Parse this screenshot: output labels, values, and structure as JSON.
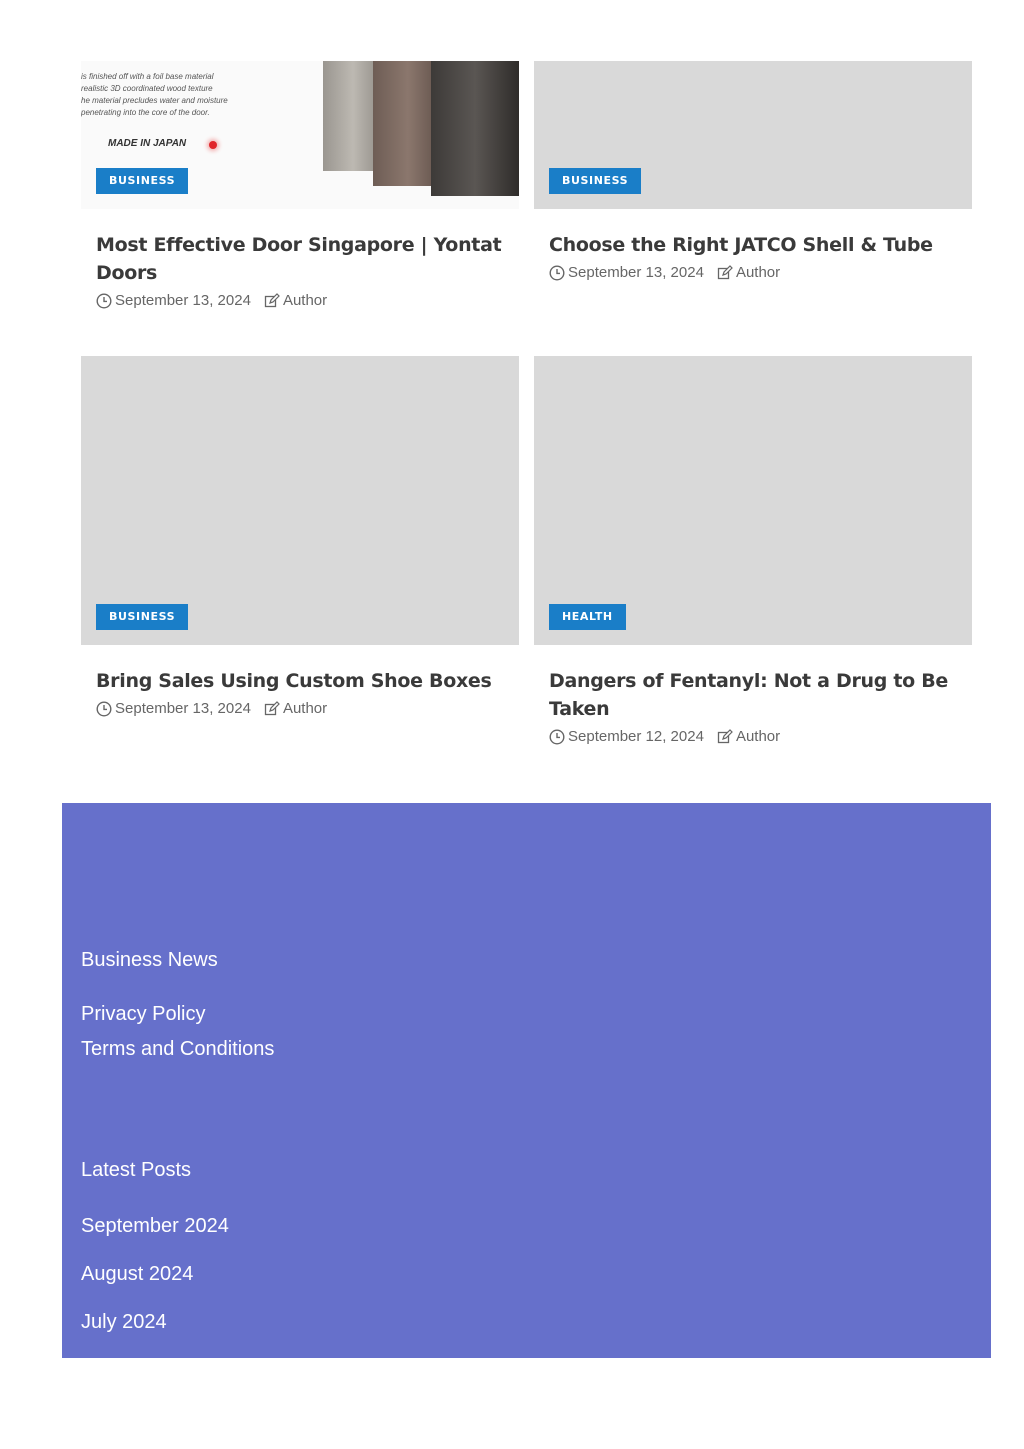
{
  "posts": [
    {
      "category": "BUSINESS",
      "title": "Most Effective Door Singapore | Yontat Doors",
      "date": "September 13, 2024",
      "author": "Author"
    },
    {
      "category": "BUSINESS",
      "title": "Choose the Right JATCO Shell & Tube",
      "date": "September 13, 2024",
      "author": "Author"
    },
    {
      "category": "BUSINESS",
      "title": "Bring Sales Using Custom Shoe Boxes",
      "date": "September 13, 2024",
      "author": "Author"
    },
    {
      "category": "HEALTH",
      "title": "Dangers of Fentanyl: Not a Drug to Be Taken",
      "date": "September 12, 2024",
      "author": "Author"
    }
  ],
  "door_image": {
    "lines": [
      "is finished off with a foil base material",
      "realistic 3D coordinated wood texture",
      "he material precludes water and moisture",
      "penetrating into the core of the door."
    ],
    "made_in": "MADE IN JAPAN"
  },
  "footer": {
    "links": [
      "Business News",
      "Privacy Policy",
      "Terms and Conditions"
    ],
    "latest_heading": "Latest Posts",
    "archives": [
      "September 2024",
      "August 2024",
      "July 2024"
    ]
  },
  "colors": {
    "badge": "#1a7ec8",
    "footer_bg": "#6670cb",
    "placeholder": "#d9d9d9"
  }
}
